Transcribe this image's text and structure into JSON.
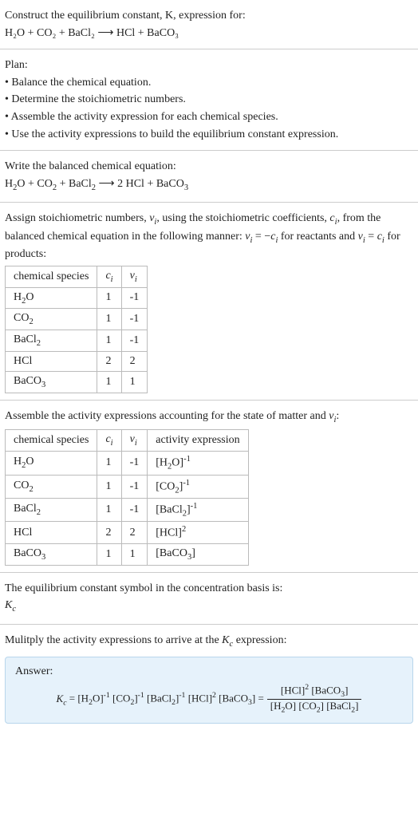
{
  "intro": {
    "title": "Construct the equilibrium constant, K, expression for:",
    "equation": "H₂O + CO₂ + BaCl₂ ⟶ HCl + BaCO₃"
  },
  "plan": {
    "heading": "Plan:",
    "items": [
      "• Balance the chemical equation.",
      "• Determine the stoichiometric numbers.",
      "• Assemble the activity expression for each chemical species.",
      "• Use the activity expressions to build the equilibrium constant expression."
    ]
  },
  "balanced": {
    "heading": "Write the balanced chemical equation:",
    "equation": "H₂O + CO₂ + BaCl₂ ⟶ 2 HCl + BaCO₃"
  },
  "stoich": {
    "heading_html": "Assign stoichiometric numbers, <span class=\"italic\">ν<sub>i</sub></span>, using the stoichiometric coefficients, <span class=\"italic\">c<sub>i</sub></span>, from the balanced chemical equation in the following manner: <span class=\"italic\">ν<sub>i</sub></span> = −<span class=\"italic\">c<sub>i</sub></span> for reactants and <span class=\"italic\">ν<sub>i</sub></span> = <span class=\"italic\">c<sub>i</sub></span> for products:",
    "headers": [
      "chemical species",
      "cᵢ",
      "νᵢ"
    ],
    "headers_html": [
      "chemical species",
      "<span class=\"italic\">c<sub>i</sub></span>",
      "<span class=\"italic\">ν<sub>i</sub></span>"
    ],
    "rows": [
      {
        "species_html": "H<sub>2</sub>O",
        "c": "1",
        "nu": "-1"
      },
      {
        "species_html": "CO<sub>2</sub>",
        "c": "1",
        "nu": "-1"
      },
      {
        "species_html": "BaCl<sub>2</sub>",
        "c": "1",
        "nu": "-1"
      },
      {
        "species_html": "HCl",
        "c": "2",
        "nu": "2"
      },
      {
        "species_html": "BaCO<sub>3</sub>",
        "c": "1",
        "nu": "1"
      }
    ]
  },
  "activity": {
    "heading_html": "Assemble the activity expressions accounting for the state of matter and <span class=\"italic\">ν<sub>i</sub></span>:",
    "headers_html": [
      "chemical species",
      "<span class=\"italic\">c<sub>i</sub></span>",
      "<span class=\"italic\">ν<sub>i</sub></span>",
      "activity expression"
    ],
    "rows": [
      {
        "species_html": "H<sub>2</sub>O",
        "c": "1",
        "nu": "-1",
        "act_html": "[H<sub>2</sub>O]<sup>-1</sup>"
      },
      {
        "species_html": "CO<sub>2</sub>",
        "c": "1",
        "nu": "-1",
        "act_html": "[CO<sub>2</sub>]<sup>-1</sup>"
      },
      {
        "species_html": "BaCl<sub>2</sub>",
        "c": "1",
        "nu": "-1",
        "act_html": "[BaCl<sub>2</sub>]<sup>-1</sup>"
      },
      {
        "species_html": "HCl",
        "c": "2",
        "nu": "2",
        "act_html": "[HCl]<sup>2</sup>"
      },
      {
        "species_html": "BaCO<sub>3</sub>",
        "c": "1",
        "nu": "1",
        "act_html": "[BaCO<sub>3</sub>]"
      }
    ]
  },
  "symbol": {
    "heading": "The equilibrium constant symbol in the concentration basis is:",
    "value_html": "<span class=\"italic\">K<sub>c</sub></span>"
  },
  "multiply": {
    "heading_html": "Mulitply the activity expressions to arrive at the <span class=\"italic\">K<sub>c</sub></span> expression:"
  },
  "answer": {
    "label": "Answer:",
    "lhs_html": "<span class=\"italic\">K<sub>c</sub></span> = [H<sub>2</sub>O]<sup>-1</sup> [CO<sub>2</sub>]<sup>-1</sup> [BaCl<sub>2</sub>]<sup>-1</sup> [HCl]<sup>2</sup> [BaCO<sub>3</sub>] =",
    "num_html": "[HCl]<sup>2</sup> [BaCO<sub>3</sub>]",
    "den_html": "[H<sub>2</sub>O] [CO<sub>2</sub>] [BaCl<sub>2</sub>]"
  },
  "chart_data": {
    "type": "table",
    "tables": [
      {
        "title": "Stoichiometric numbers",
        "columns": [
          "chemical species",
          "c_i",
          "ν_i"
        ],
        "rows": [
          [
            "H2O",
            1,
            -1
          ],
          [
            "CO2",
            1,
            -1
          ],
          [
            "BaCl2",
            1,
            -1
          ],
          [
            "HCl",
            2,
            2
          ],
          [
            "BaCO3",
            1,
            1
          ]
        ]
      },
      {
        "title": "Activity expressions",
        "columns": [
          "chemical species",
          "c_i",
          "ν_i",
          "activity expression"
        ],
        "rows": [
          [
            "H2O",
            1,
            -1,
            "[H2O]^-1"
          ],
          [
            "CO2",
            1,
            -1,
            "[CO2]^-1"
          ],
          [
            "BaCl2",
            1,
            -1,
            "[BaCl2]^-1"
          ],
          [
            "HCl",
            2,
            2,
            "[HCl]^2"
          ],
          [
            "BaCO3",
            1,
            1,
            "[BaCO3]"
          ]
        ]
      }
    ]
  }
}
